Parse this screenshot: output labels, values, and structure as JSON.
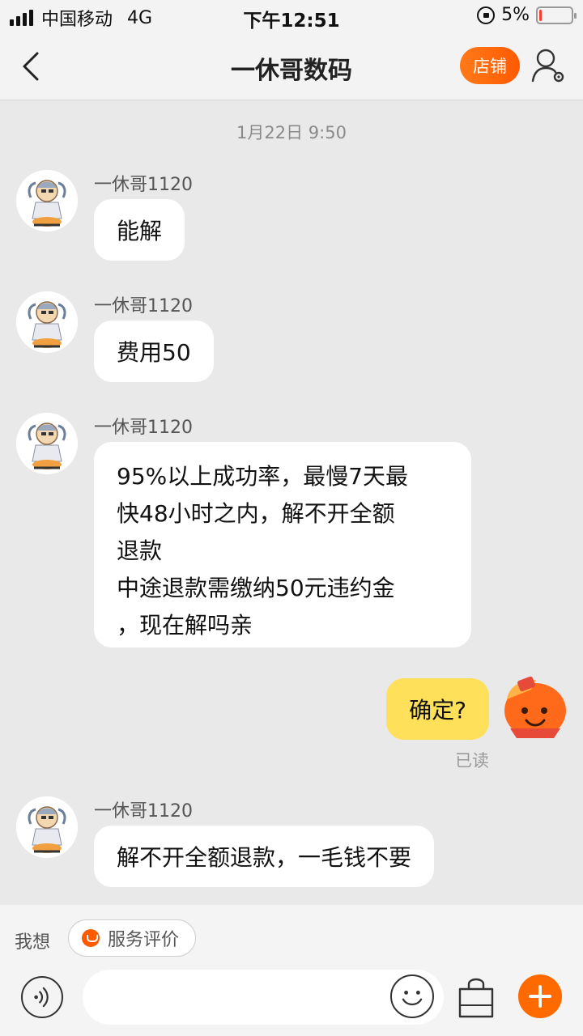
{
  "status_bar": {
    "carrier": "中国移动",
    "network": "4G",
    "time": "下午12:51",
    "battery_percent": "5%",
    "battery_level": 0.05,
    "icons": [
      "signal-icon",
      "rotation-lock-icon",
      "battery-icon"
    ]
  },
  "nav": {
    "title": "一休哥数码",
    "shop_label": "店铺",
    "icons": [
      "back-arrow-icon",
      "user-settings-icon"
    ]
  },
  "chat": {
    "timestamp": "1月22日 9:50",
    "messages": [
      {
        "sender": "一休哥1120",
        "text": "能解"
      },
      {
        "sender": "一休哥1120",
        "text": "费用50"
      },
      {
        "sender": "一休哥1120",
        "text": "95%以上成功率，最慢7天最\n快48小时之内，解不开全额\n退款\n中途退款需缴纳50元违约金\n，现在解吗亲"
      },
      {
        "sender": "me",
        "text": "确定?",
        "status": "已读"
      },
      {
        "sender": "一休哥1120",
        "text": "解不开全额退款，一毛钱不要"
      }
    ]
  },
  "quick_bar": {
    "label": "我想",
    "chip_label": "服务评价"
  },
  "input_bar": {
    "placeholder": "",
    "icons": [
      "voice-icon",
      "emoji-icon",
      "shopping-bag-icon",
      "plus-icon"
    ]
  },
  "colors": {
    "accent": "#ff6a00",
    "my_bubble": "#ffe05a",
    "background": "#e9e9e9"
  }
}
